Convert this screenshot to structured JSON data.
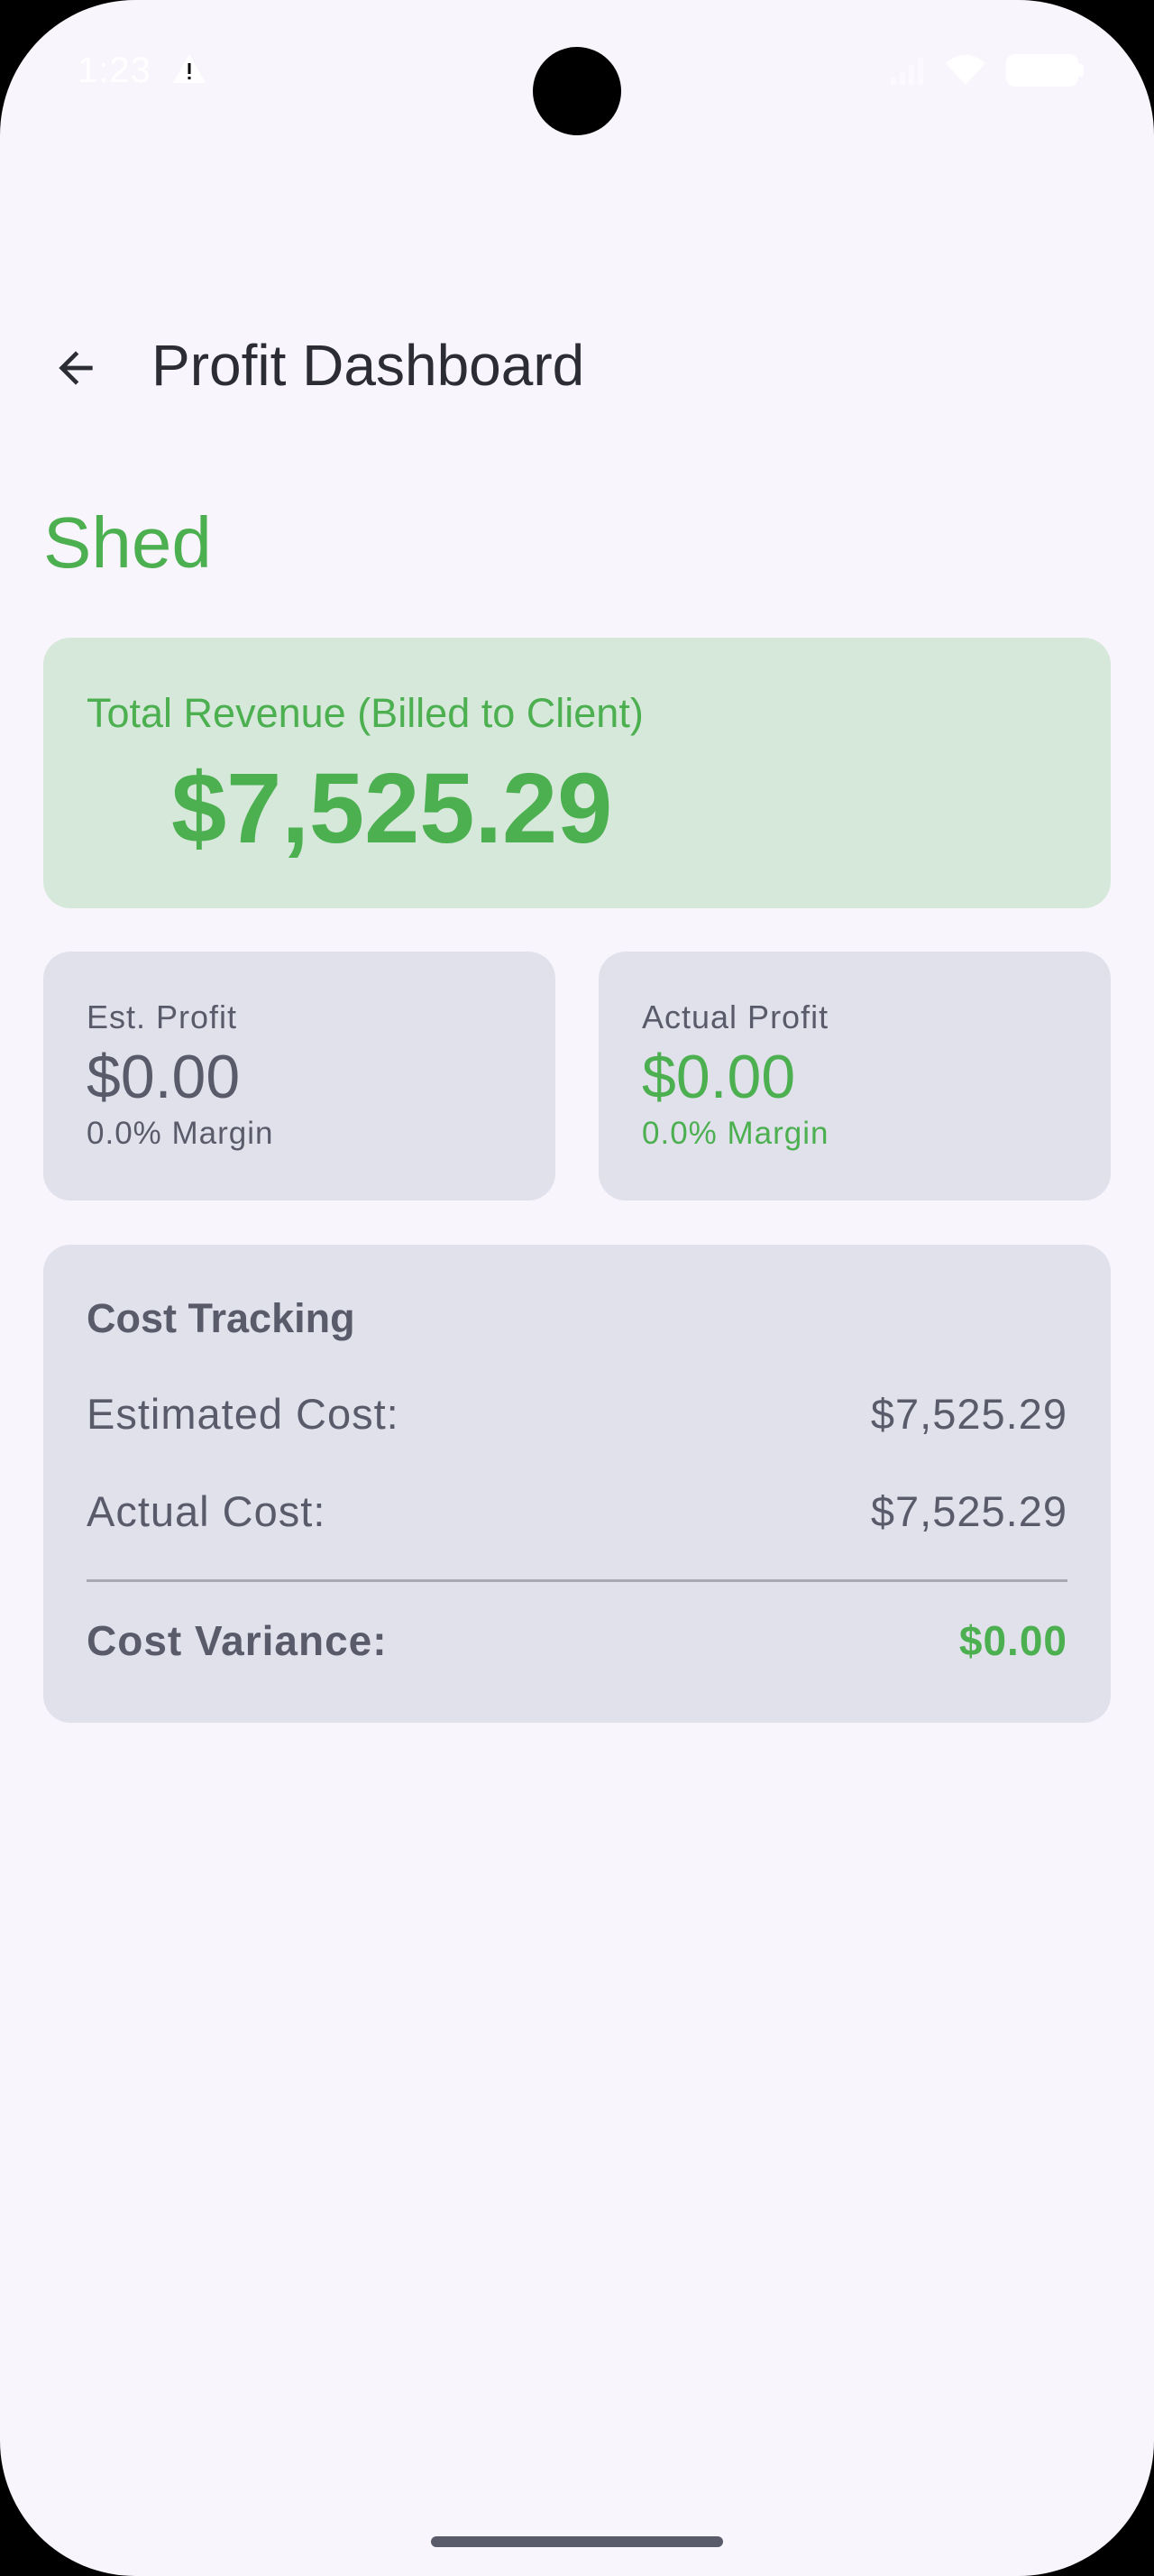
{
  "status_bar": {
    "time": "1:23",
    "icons": [
      "warning-icon",
      "signal-icon",
      "wifi-icon",
      "battery-icon"
    ]
  },
  "app_bar": {
    "back_icon": "arrow-back-icon",
    "title": "Profit Dashboard"
  },
  "project": {
    "name": "Shed"
  },
  "revenue": {
    "label": "Total Revenue (Billed to Client)",
    "value": "$7,525.29"
  },
  "est_profit": {
    "label": "Est. Profit",
    "value": "$0.00",
    "margin": "0.0% Margin"
  },
  "actual_profit": {
    "label": "Actual Profit",
    "value": "$0.00",
    "margin": "0.0% Margin"
  },
  "cost_tracking": {
    "title": "Cost Tracking",
    "estimated_label": "Estimated Cost:",
    "estimated_value": "$7,525.29",
    "actual_label": "Actual Cost:",
    "actual_value": "$7,525.29",
    "variance_label": "Cost Variance:",
    "variance_value": "$0.00"
  },
  "colors": {
    "accent_green": "#4caf50",
    "revenue_card_bg": "#d6e8da",
    "card_bg": "#e1e1ec",
    "page_bg": "#f8f5fc",
    "text_muted": "#5a5b6a"
  }
}
